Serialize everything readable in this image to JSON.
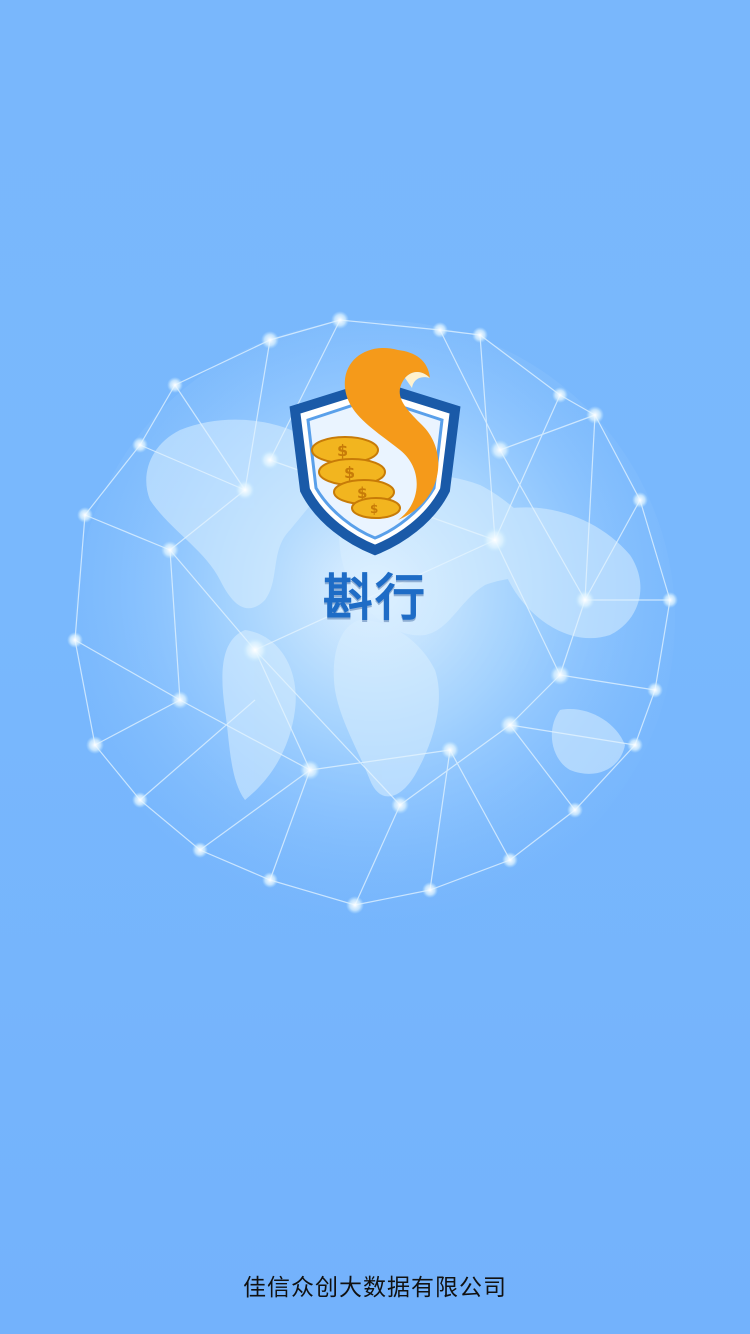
{
  "screen": {
    "type": "splash",
    "background_color": "#77b6fc"
  },
  "logo": {
    "icon": "shield-coins-flame-logo",
    "shield_color": "#1a5aa8",
    "flame_color": "#f59a1a",
    "coin_color": "#f2b51f"
  },
  "brand": {
    "name": "斟行",
    "color": "#1e6cc6"
  },
  "background": {
    "illustration": "network-globe-icon"
  },
  "footer": {
    "company": "佳信众创大数据有限公司"
  }
}
